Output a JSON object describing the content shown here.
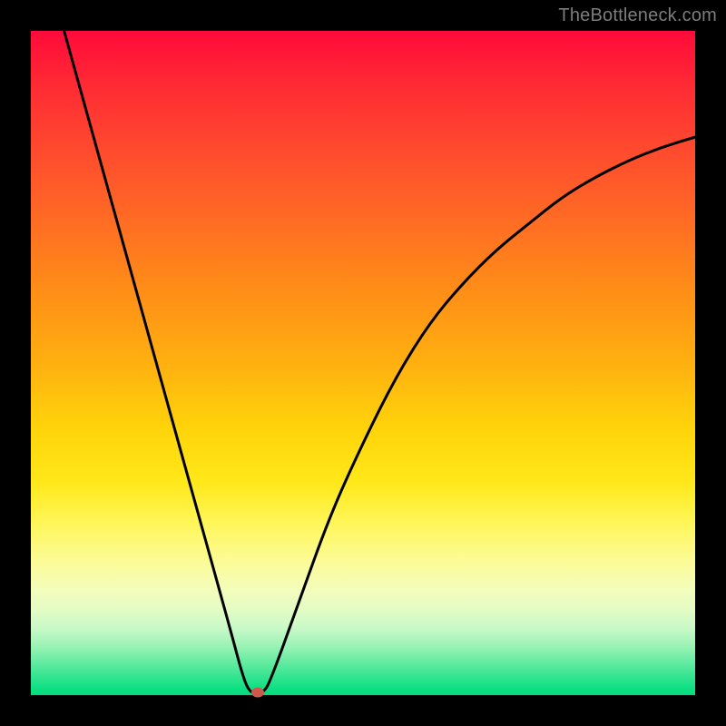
{
  "watermark": "TheBottleneck.com",
  "chart_data": {
    "type": "line",
    "title": "",
    "xlabel": "",
    "ylabel": "",
    "xlim": [
      0,
      100
    ],
    "ylim": [
      0,
      100
    ],
    "grid": false,
    "series": [
      {
        "name": "curve",
        "x": [
          5,
          10,
          15,
          20,
          25,
          30,
          32,
          33,
          34,
          35,
          36,
          40,
          45,
          50,
          55,
          60,
          65,
          70,
          75,
          80,
          85,
          90,
          95,
          100
        ],
        "y": [
          100,
          82,
          64,
          46,
          28,
          10,
          2.5,
          0.4,
          0.4,
          0.4,
          2,
          13,
          27,
          38,
          48,
          56,
          62,
          67,
          71,
          75,
          78,
          80.5,
          82.5,
          84
        ]
      }
    ],
    "marker": {
      "x": 34.2,
      "y": 0.4,
      "color": "#cc5a4a"
    },
    "background_gradient": {
      "top": "#ff0a3a",
      "mid": "#ffd40a",
      "bottom": "#06da7c"
    }
  }
}
